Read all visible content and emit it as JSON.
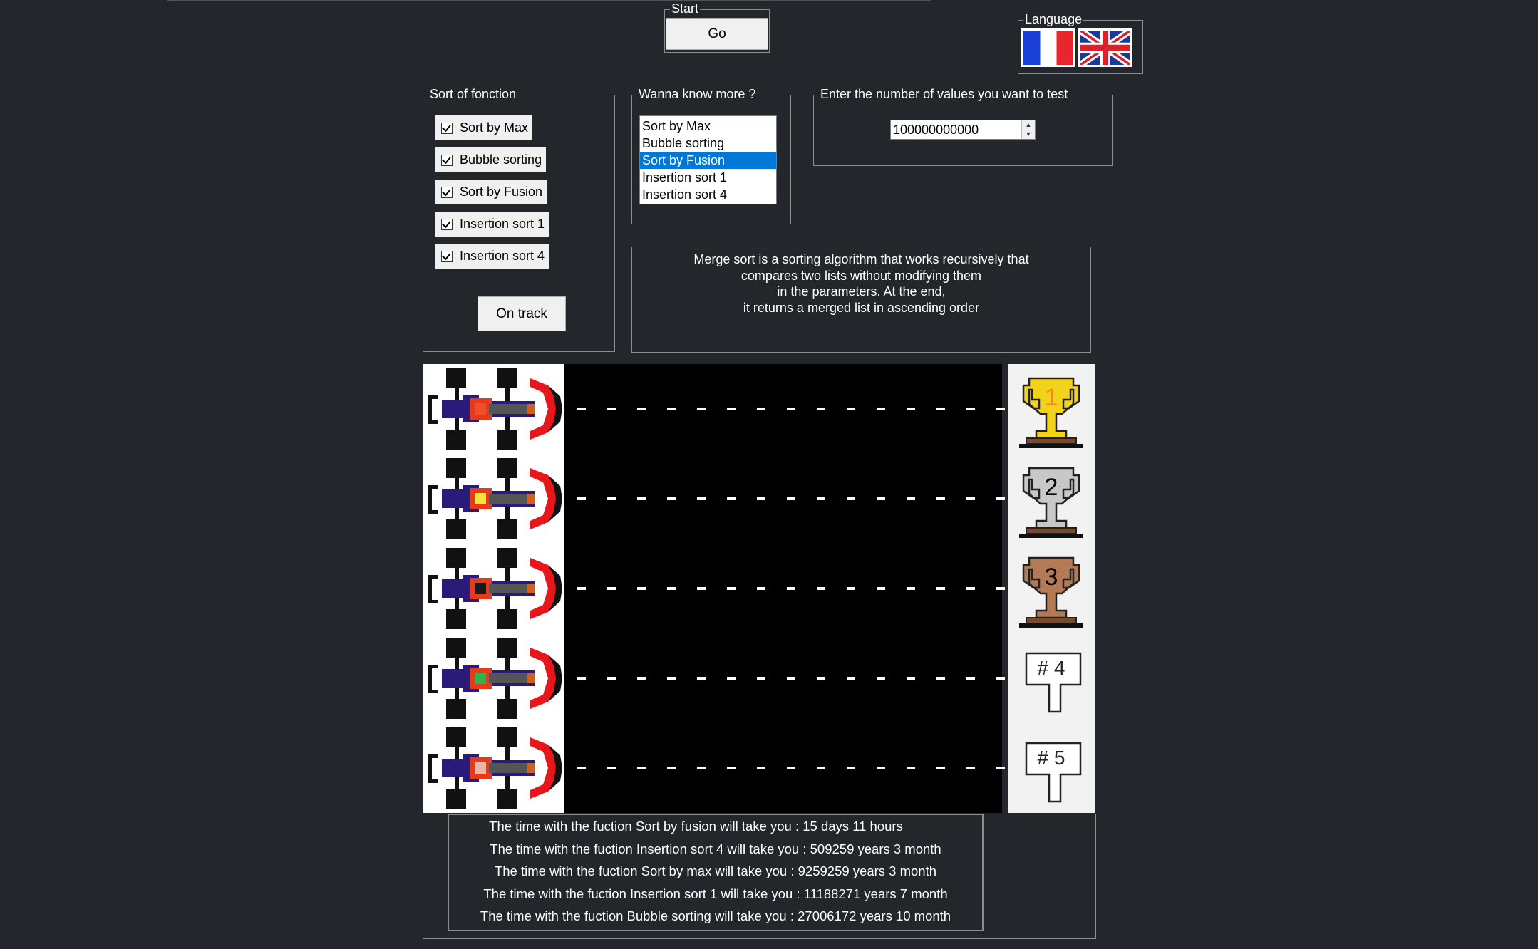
{
  "start": {
    "legend": "Start",
    "go_label": "Go"
  },
  "language": {
    "legend": "Language",
    "options": [
      {
        "name": "French",
        "icon": "france-flag-icon"
      },
      {
        "name": "English",
        "icon": "uk-flag-icon"
      }
    ]
  },
  "sort_group": {
    "legend": "Sort of fonction",
    "checkboxes": [
      {
        "label": "Sort by Max",
        "checked": true
      },
      {
        "label": "Bubble sorting",
        "checked": true
      },
      {
        "label": "Sort by Fusion",
        "checked": true
      },
      {
        "label": "Insertion sort 1",
        "checked": true
      },
      {
        "label": "Insertion sort 4",
        "checked": true
      }
    ],
    "on_track_label": "On track"
  },
  "info_group": {
    "legend": "Wanna know more ?",
    "items": [
      "Sort by Max",
      "Bubble sorting",
      "Sort by Fusion",
      "Insertion sort 1",
      "Insertion sort 4"
    ],
    "selected_index": 2
  },
  "values_group": {
    "legend": "Enter the number of values you want to test",
    "value": "100000000000"
  },
  "description": {
    "lines": [
      "Merge sort is a sorting algorithm that works recursively that",
      "compares two lists without modifying them",
      "in the parameters. At the end,",
      "it returns a merged list in ascending order"
    ]
  },
  "race": {
    "lanes": [
      {
        "cockpit_color": "#f04f2a",
        "place": "1",
        "trophy": "gold-trophy-icon"
      },
      {
        "cockpit_color": "#f5e23a",
        "place": "2",
        "trophy": "silver-trophy-icon"
      },
      {
        "cockpit_color": "#1a1a1a",
        "place": "3",
        "trophy": "bronze-trophy-icon"
      },
      {
        "cockpit_color": "#2fb34a",
        "place": "# 4",
        "trophy": "place-4-sign-icon"
      },
      {
        "cockpit_color": "#e8b8a8",
        "place": "# 5",
        "trophy": "place-5-sign-icon"
      }
    ]
  },
  "results": {
    "lines": [
      "The time with the fuction Sort by fusion will take you : 15 days 11 hours",
      "The time with the fuction Insertion sort 4 will take you : 509259 years 3 month",
      "The time with the fuction Sort by max will take you : 9259259 years 3 month",
      "The time with the fuction Insertion sort 1 will take you : 11188271 years 7 month",
      "The time with the fuction Bubble sorting  will take you : 27006172 years 10 month"
    ]
  },
  "colors": {
    "background": "#23262a",
    "selection": "#0078d7",
    "gold": "#f3d21a",
    "silver": "#c8c8c8",
    "bronze": "#b37a55"
  }
}
